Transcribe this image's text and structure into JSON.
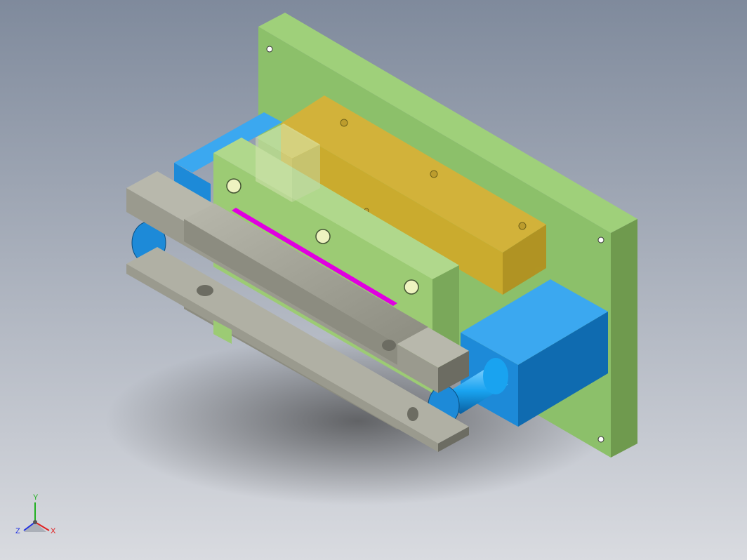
{
  "viewport": {
    "background_top": "#7f8a9c",
    "background_bottom": "#d9dbe0"
  },
  "colors": {
    "base_plate": "#8cc06a",
    "base_plate_side": "#6f9a4e",
    "holder_plate": "#9ccb74",
    "yellow_block": "#d8a722",
    "blue_block": "#1d8ad8",
    "blue_side": "#0f6bb0",
    "gray_part": "#9a9a8e",
    "gray_dark": "#6c6c62",
    "magenta_strip": "#e000e0"
  },
  "triad": {
    "x_label": "X",
    "y_label": "Y",
    "z_label": "Z",
    "x_color": "#e02020",
    "y_color": "#20b020",
    "z_color": "#2030e0"
  }
}
